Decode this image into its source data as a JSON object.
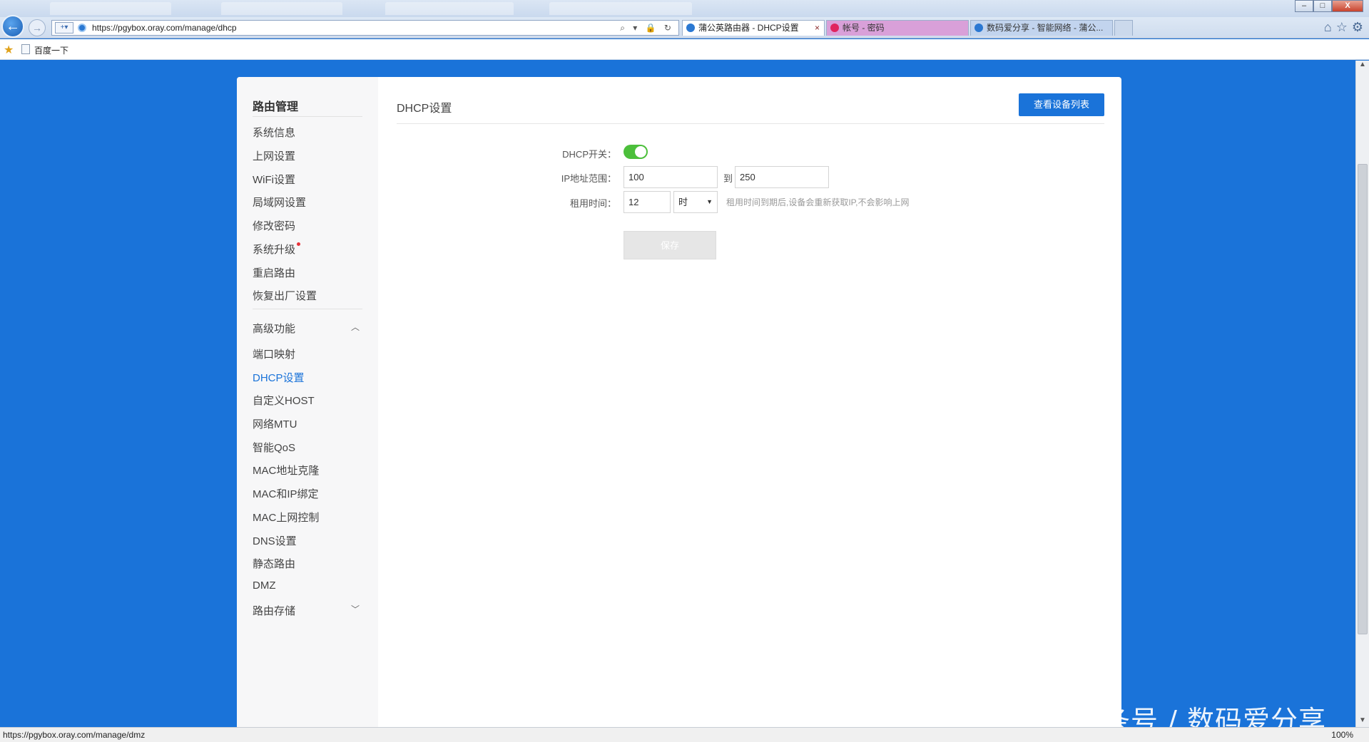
{
  "browser": {
    "faded_tabs": [
      "",
      "",
      "",
      ""
    ],
    "url": "https://pgybox.oray.com/manage/dhcp",
    "tabs": [
      {
        "label": "蒲公英路由器 - DHCP设置",
        "state": "active"
      },
      {
        "label": "帐号 - 密码",
        "state": "pink"
      },
      {
        "label": "数码爱分享 - 智能网络 - 蒲公...",
        "state": "blue"
      }
    ],
    "tab_close": "×",
    "favorites_item": "百度一下",
    "status_url": "https://pgybox.oray.com/manage/dmz",
    "zoom": "100%",
    "win": {
      "min": "–",
      "max": "□",
      "close": "X"
    },
    "address_tools": "⌕ ▾ 🔒 ↻",
    "tool_icons": {
      "home": "⌂",
      "star": "☆",
      "gear": "⚙"
    }
  },
  "sidebar": {
    "title": "路由管理",
    "items": [
      "系统信息",
      "上网设置",
      "WiFi设置",
      "局域网设置",
      "修改密码",
      "系统升级",
      "重启路由",
      "恢复出厂设置"
    ],
    "group_title": "高级功能",
    "group_items": [
      "端口映射",
      "DHCP设置",
      "自定义HOST",
      "网络MTU",
      "智能QoS",
      "MAC地址克隆",
      "MAC和IP绑定",
      "MAC上网控制",
      "DNS设置",
      "静态路由",
      "DMZ",
      "路由存储"
    ]
  },
  "main": {
    "title": "DHCP设置",
    "device_list_button": "查看设备列表",
    "form": {
      "dhcp_switch_label": "DHCP开关：",
      "dhcp_enabled": true,
      "ip_range_label": "IP地址范围：",
      "ip_start": "100",
      "ip_to": "到",
      "ip_end": "250",
      "lease_label": "租用时间：",
      "lease_value": "12",
      "lease_unit": "时",
      "lease_hint": "租用时间到期后,设备会重新获取IP,不会影响上网",
      "save_button": "保存"
    }
  },
  "watermark": "头条号 / 数码爱分享",
  "colors": {
    "accent": "#1a73d9",
    "toggle_on": "#4cbf3b",
    "badge": "#e7323a"
  }
}
